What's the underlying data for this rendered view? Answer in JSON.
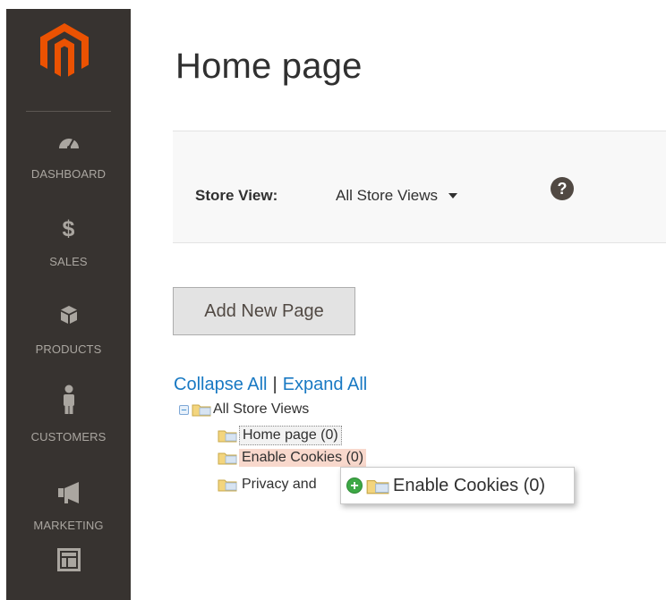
{
  "sidebar": {
    "items": [
      {
        "label": "DASHBOARD",
        "icon": "dashboard-gauge-icon"
      },
      {
        "label": "SALES",
        "icon": "dollar-icon",
        "glyph": "$"
      },
      {
        "label": "PRODUCTS",
        "icon": "box-icon"
      },
      {
        "label": "CUSTOMERS",
        "icon": "person-icon"
      },
      {
        "label": "MARKETING",
        "icon": "megaphone-icon"
      },
      {
        "label": "",
        "icon": "layout-icon"
      }
    ]
  },
  "page": {
    "title": "Home page"
  },
  "store_switcher": {
    "label": "Store View:",
    "selected": "All Store Views",
    "help_glyph": "?"
  },
  "actions": {
    "add_new_page": "Add New Page"
  },
  "tree": {
    "collapse_all": "Collapse All",
    "separator": "|",
    "expand_all": "Expand All",
    "expander_glyph": "−",
    "root": "All Store Views",
    "children": [
      {
        "label": "Home page (0)",
        "state": "selected"
      },
      {
        "label": "Enable Cookies (0)",
        "state": "drop-target"
      },
      {
        "label": "Privacy and",
        "state": "normal"
      }
    ],
    "drag_ghost": {
      "label": "Enable Cookies (0)",
      "plus_glyph": "+"
    }
  },
  "colors": {
    "sidebar_bg": "#373330",
    "sidebar_text": "#aaa6a0",
    "brand_orange": "#eb5202",
    "link_blue": "#1979c3",
    "drop_highlight": "#f8d8cc"
  }
}
